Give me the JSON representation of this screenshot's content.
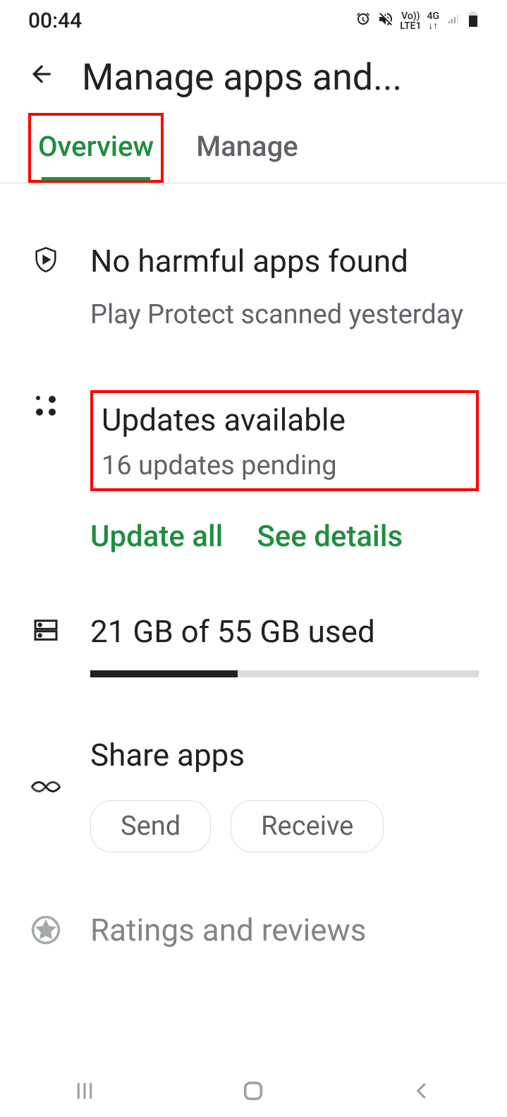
{
  "status_bar": {
    "time": "00:44",
    "network_label": "LTE1",
    "network_type": "4G"
  },
  "header": {
    "title": "Manage apps and..."
  },
  "tabs": {
    "overview": "Overview",
    "manage": "Manage"
  },
  "play_protect": {
    "title": "No harmful apps found",
    "subtitle": "Play Protect scanned yesterday"
  },
  "updates": {
    "title": "Updates available",
    "subtitle": "16 updates pending",
    "update_all_label": "Update all",
    "see_details_label": "See details"
  },
  "storage": {
    "title": "21 GB of 55 GB used",
    "used_percent": 38
  },
  "share": {
    "title": "Share apps",
    "send_label": "Send",
    "receive_label": "Receive"
  },
  "ratings": {
    "title": "Ratings and reviews"
  }
}
